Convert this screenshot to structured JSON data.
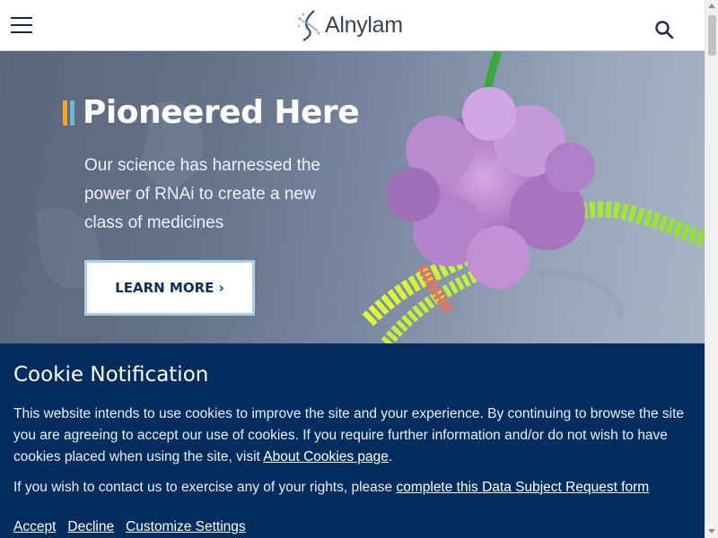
{
  "header": {
    "menu_icon": "hamburger-menu-icon",
    "logo_text": "Alnylam",
    "search_icon": "search-icon"
  },
  "hero": {
    "title": "Pioneered Here",
    "subtitle": "Our science has harnessed the power of RNAi to create a new class of medicines",
    "cta_label": "LEARN MORE ›",
    "accent_colors": [
      "#f5a623",
      "#6fb7d8"
    ]
  },
  "cookie": {
    "title": "Cookie Notification",
    "body_1": "This website intends to use cookies to improve the site and your experience. By continuing to browse the site you are agreeing to accept our use of cookies. If you require further information and/or do not wish to have cookies placed when using the site, visit ",
    "about_link": "About Cookies page",
    "body_1_end": ".",
    "body_2": "If you wish to contact us to exercise any of your rights, please ",
    "dsr_link": "complete this Data Subject Request form",
    "accept_label": "Accept",
    "decline_label": "Decline",
    "customize_label": "Customize Settings",
    "background_color": "#022d5e"
  }
}
